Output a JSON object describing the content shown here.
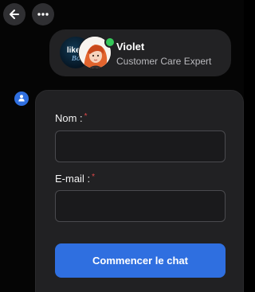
{
  "nav": {
    "back_icon": "arrow-left-icon",
    "more_icon": "more-horizontal-icon"
  },
  "agent": {
    "name": "Violet",
    "role": "Customer Care Expert",
    "status": "online",
    "logo_text_top": "likes",
    "logo_text_bottom": "Bot"
  },
  "bot_avatar_icon": "user-icon",
  "form": {
    "name_label": "Nom :",
    "name_value": "",
    "email_label": "E-mail :",
    "email_value": "",
    "required_marker": "*",
    "submit_label": "Commencer le chat"
  },
  "colors": {
    "accent": "#2f6fe0",
    "online": "#34c759",
    "required": "#e04848",
    "background": "#050505",
    "card": "#212123"
  }
}
